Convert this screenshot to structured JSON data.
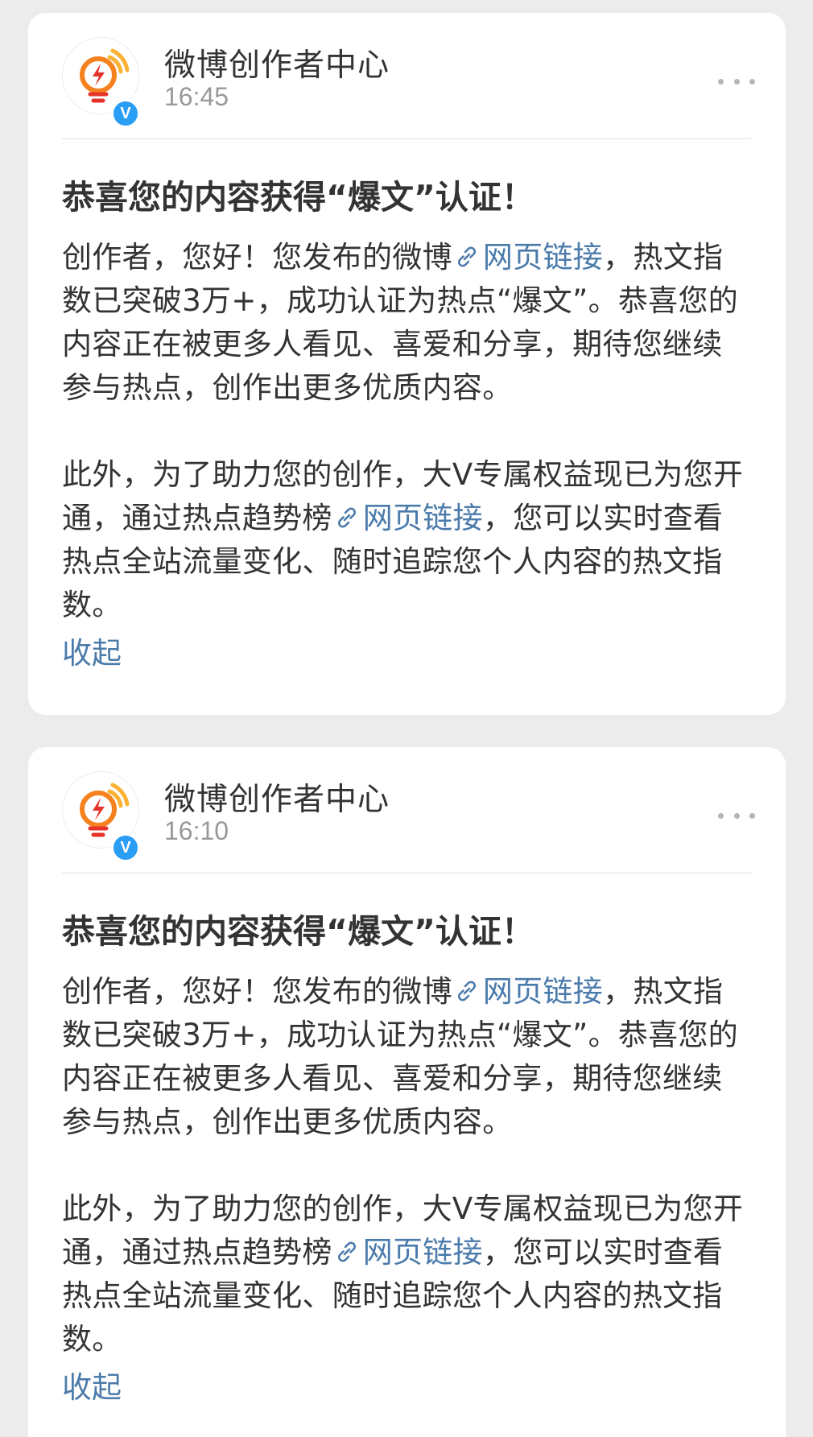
{
  "feed": {
    "cards": [
      {
        "account_name": "微博创作者中心",
        "time": "16:45",
        "verified_mark": "V",
        "title": "恭喜您的内容获得“爆文”认证！",
        "p1_a": "创作者，您好！您发布的微博",
        "p1_link": "网页链接",
        "p1_b": "，热文指数已突破3万+，成功认证为热点“爆文”。恭喜您的内容正在被更多人看见、喜爱和分享，期待您继续参与热点，创作出更多优质内容。",
        "p2_a": "此外，为了助力您的创作，大V专属权益现已为您开通，通过热点趋势榜",
        "p2_link": "网页链接",
        "p2_b": "，您可以实时查看热点全站流量变化、随时追踪您个人内容的热文指数。",
        "collapse_label": "收起"
      },
      {
        "account_name": "微博创作者中心",
        "time": "16:10",
        "verified_mark": "V",
        "title": "恭喜您的内容获得“爆文”认证！",
        "p1_a": "创作者，您好！您发布的微博",
        "p1_link": "网页链接",
        "p1_b": "，热文指数已突破3万+，成功认证为热点“爆文”。恭喜您的内容正在被更多人看见、喜爱和分享，期待您继续参与热点，创作出更多优质内容。",
        "p2_a": "此外，为了助力您的创作，大V专属权益现已为您开通，通过热点趋势榜",
        "p2_link": "网页链接",
        "p2_b": "，您可以实时查看热点全站流量变化、随时追踪您个人内容的热文指数。",
        "collapse_label": "收起"
      }
    ]
  },
  "icons": {
    "avatar": "lightbulb-lightning-logo",
    "badge": "verified-v-icon",
    "more": "more-dots-icon",
    "link": "link-chain-icon"
  },
  "colors": {
    "link": "#4b7bab",
    "verified": "#2a9df4",
    "logo_orange": "#f5821f",
    "logo_red": "#e6332a",
    "logo_yellow": "#f9b233",
    "background": "#ececec"
  }
}
